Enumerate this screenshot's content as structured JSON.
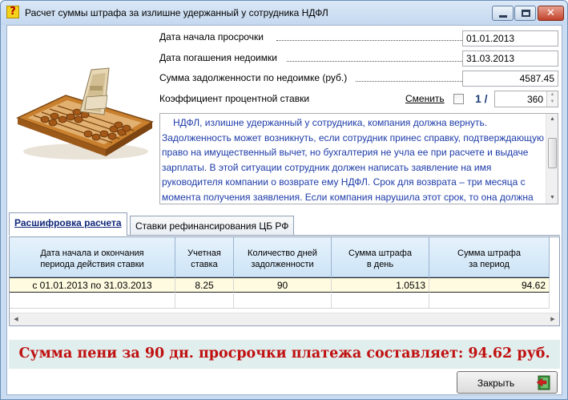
{
  "window": {
    "title": "Расчет суммы штрафа за излишне удержанный у сотрудника НДФЛ",
    "app_icon": "?"
  },
  "form": {
    "start_label": "Дата начала просрочки",
    "start_value": "01.01.2013",
    "end_label": "Дата погашения недоимки",
    "end_value": "31.03.2013",
    "debt_label": "Сумма задолженности по недоимке (руб.)",
    "debt_value": "4587.45",
    "rate_label": "Коэффициент процентной ставки",
    "change_link": "Сменить",
    "ratio_prefix": "1 /",
    "ratio_value": "360"
  },
  "description": "НДФЛ, излишне удержанный у сотрудника, компания должна вернуть. Задолженность может возникнуть, если сотрудник принес справку, подтверждающую право на имущественный вычет, но бухгалтерия не учла ее при расчете и выдаче зарплаты. В этой ситуации сотрудник должен написать заявление на имя руководителя компании о возврате ему НДФЛ. Срок для возврата – три месяца с момента получения заявления. Если компания нарушила этот срок, то она должна выплатить штраф за каждый календарный день просрочки.",
  "tabs": [
    "Расшифровка расчета",
    "Ставки рефинансирования ЦБ РФ"
  ],
  "table": {
    "headers": [
      [
        "Дата начала и окончания",
        "периода действия ставки"
      ],
      [
        "Учетная",
        "ставка"
      ],
      [
        "Количество дней",
        "задолженности"
      ],
      [
        "Сумма штрафа",
        "в день"
      ],
      [
        "Сумма штрафа",
        "за период"
      ]
    ],
    "rows": [
      [
        "с 01.01.2013 по 31.03.2013",
        "8.25",
        "90",
        "1.0513",
        "94.62"
      ]
    ]
  },
  "summary": "Сумма пени за 90 дн. просрочки платежа составляет:  94.62 руб.",
  "close_button": "Закрыть"
}
